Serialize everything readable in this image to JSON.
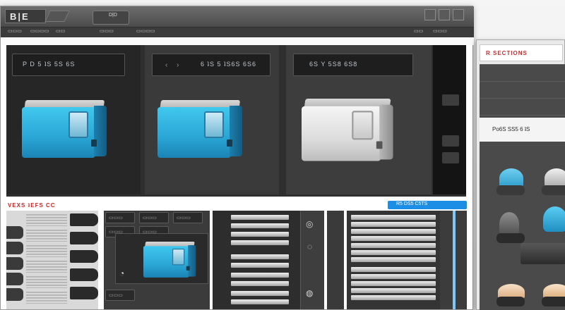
{
  "titlebar": {
    "logo": "B|E",
    "tab_label": "D|D",
    "menu": [
      "▭▭▭",
      "▭▭▭▭",
      "▭▭",
      "▭▭▭",
      "▭▭▭▭"
    ],
    "menu_right": [
      "▭▭",
      "▭▭▭"
    ]
  },
  "products": [
    {
      "label": "P D   5 ʇS 5S 6S",
      "variant": "blue"
    },
    {
      "label": "6 ʇS 5 ʇS6S 6S6",
      "variant": "blue"
    },
    {
      "label": "6S  Y 5S8 6S8",
      "variant": "white"
    }
  ],
  "section": {
    "title": "VEXS ʇEFS CC",
    "action_button": "R5 DS5 C5TS"
  },
  "panel_tabs": {
    "left_group": [
      "▭▭▭",
      "▭▭▭",
      "▭▭▭",
      "▭▭▭",
      "▭▭▭",
      "▭▭▭"
    ]
  },
  "side_window": {
    "title": "R SECTIONS",
    "banner": "Po6S SS5 6 ʇS"
  },
  "colors": {
    "accent_blue": "#1c8ee6",
    "brand_red": "#d62323",
    "device_cyan": "#2aa6d5"
  }
}
